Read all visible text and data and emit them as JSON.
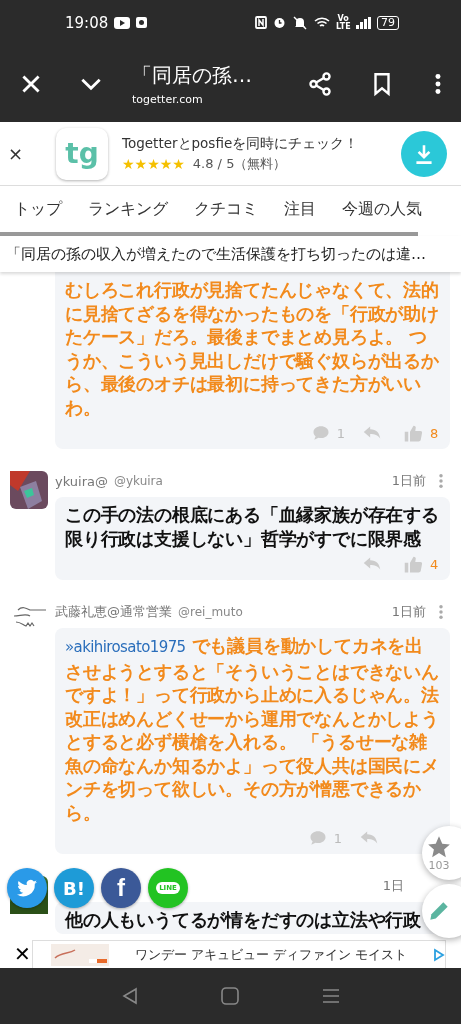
{
  "status_bar": {
    "time": "19:08",
    "network_label": "Vo LTE",
    "battery": "79"
  },
  "toolbar": {
    "title": "「同居の孫…",
    "url": "togetter.com"
  },
  "app_banner": {
    "close_label": "×",
    "icon_label": "tg",
    "title": "Togetterとposfieを同時にチェック！",
    "stars": 5,
    "rating": "4.8 / 5（無料）"
  },
  "tabs": [
    {
      "label": "トップ"
    },
    {
      "label": "ランキング"
    },
    {
      "label": "クチコミ"
    },
    {
      "label": "注目"
    },
    {
      "label": "今週の人気"
    }
  ],
  "page_title": "「同居の孫の収入が増えたので生活保護を打ち切ったのは違…",
  "comments": [
    {
      "emphasis": true,
      "text": "むしろこれ行政が見捨てたんじゃなくて、法的に見捨てざるを得なかったものを「行政が助けたケース」だろ。最後までまとめ見ろよ。 つうか、こういう見出しだけで騒ぐ奴らが出るから、最後のオチは最初に持ってきた方がいいわ。",
      "replies": "1",
      "likes": "8"
    },
    {
      "name": "ykuira@",
      "handle": "@ykuira",
      "time": "1日前",
      "emphasis": false,
      "text": "この手の法の根底にある「血縁家族が存在する限り行政は支援しない」哲学がすでに限界感",
      "likes": "4"
    },
    {
      "avatar": {
        "kind": "sketch"
      },
      "name": "武藤礼恵@通常営業",
      "handle": "@rei_muto",
      "time": "1日前",
      "emphasis": true,
      "reply_to": "»akihirosato1975",
      "text": "でも議員を動かしてカネを出させようとすると「そういうことはできないんですよ！」って行政から止めに入るじゃん。法改正はめんどくせーから運用でなんとかしようとすると必ず横槍を入れる。 「うるせーな雑魚の命なんか知るかよ」って役人共は国民にメンチを切って欲しい。その方が憎悪できるから。",
      "replies": "1"
    },
    {
      "avatar": {
        "kind": "green"
      },
      "time": "1日",
      "emphasis": false,
      "text": "他の人もいうてるが情をだすのは立法や行政"
    }
  ],
  "share_buttons": [
    {
      "kind": "twitter"
    },
    {
      "kind": "hatena",
      "label": "B!"
    },
    {
      "kind": "facebook",
      "label": "f"
    },
    {
      "kind": "line",
      "label": "LINE"
    }
  ],
  "favorite": {
    "count": "103"
  },
  "ad": {
    "close_label": "✕",
    "text": "ワンデー アキュビュー ディファイン モイスト"
  }
}
